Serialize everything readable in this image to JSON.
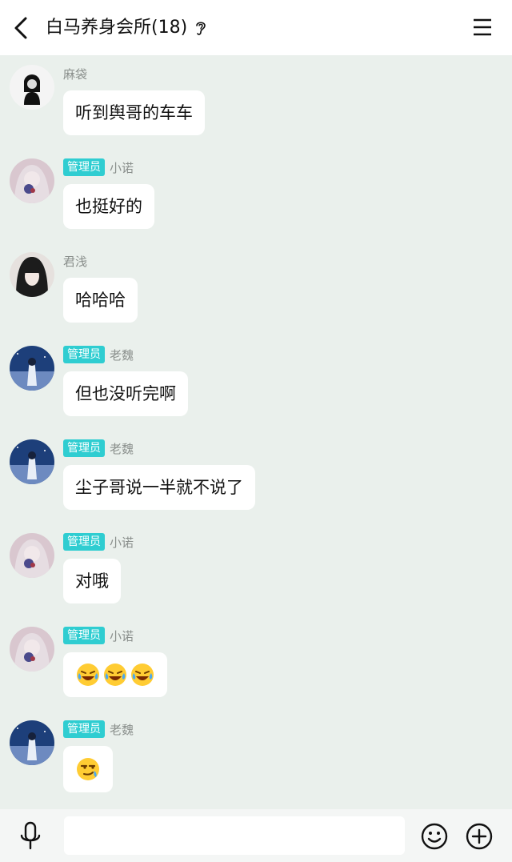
{
  "header": {
    "title": "白马养身会所(18)",
    "back_icon": "chevron-left-icon",
    "ear_icon": "ear-icon",
    "menu_icon": "hamburger-menu-icon"
  },
  "messages": [
    {
      "nick": "麻袋",
      "admin": false,
      "text": "听到舆哥的车车",
      "avatar": "avatar-madai"
    },
    {
      "nick": "小诺",
      "admin": true,
      "badge": "管理员",
      "text": "也挺好的",
      "avatar": "avatar-xiaonuo"
    },
    {
      "nick": "君浅",
      "admin": false,
      "text": "哈哈哈",
      "avatar": "avatar-junqian"
    },
    {
      "nick": "老魏",
      "admin": true,
      "badge": "管理员",
      "text": "但也没听完啊",
      "avatar": "avatar-laowei"
    },
    {
      "nick": "老魏",
      "admin": true,
      "badge": "管理员",
      "text": "尘子哥说一半就不说了",
      "avatar": "avatar-laowei"
    },
    {
      "nick": "小诺",
      "admin": true,
      "badge": "管理员",
      "text": "对哦",
      "avatar": "avatar-xiaonuo"
    },
    {
      "nick": "小诺",
      "admin": true,
      "badge": "管理员",
      "emojis": [
        "laugh-cry-emoji",
        "laugh-cry-emoji",
        "laugh-cry-emoji"
      ],
      "avatar": "avatar-xiaonuo"
    },
    {
      "nick": "老魏",
      "admin": true,
      "badge": "管理员",
      "emojis": [
        "smirk-emoji"
      ],
      "avatar": "avatar-laowei"
    }
  ],
  "bottom": {
    "input_value": "",
    "mic_icon": "microphone-icon",
    "emoji_icon": "smiley-icon",
    "plus_icon": "plus-circle-icon"
  },
  "colors": {
    "background": "#eaf0ec",
    "badge": "#2fcdd1",
    "bubble": "#ffffff"
  }
}
